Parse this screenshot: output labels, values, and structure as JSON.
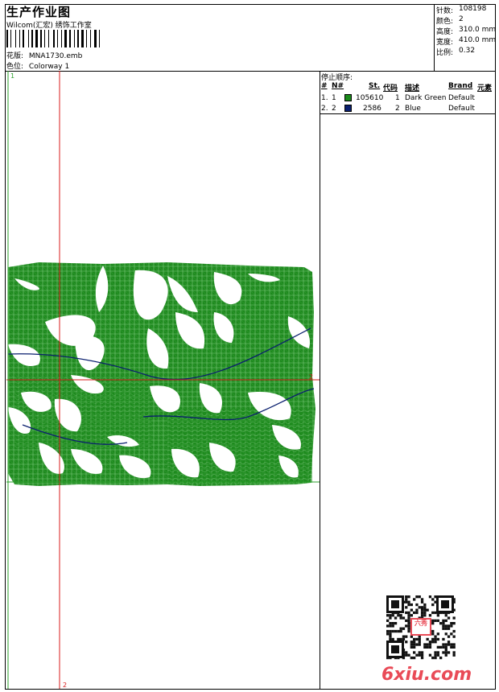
{
  "header": {
    "title": "生产作业图",
    "company": "Wilcom(汇宏) 绣饰工作室",
    "design_label": "花版:",
    "design_value": "MNA1730.emb",
    "colorway_label": "色位:",
    "colorway_value": "Colorway 1"
  },
  "specs": [
    {
      "label": "针数:",
      "value": "108198"
    },
    {
      "label": "颜色:",
      "value": "2"
    },
    {
      "label": "高度:",
      "value": "310.0 mm"
    },
    {
      "label": "宽度:",
      "value": "410.0 mm"
    },
    {
      "label": "比例:",
      "value": "0.32"
    }
  ],
  "stop_sequence": {
    "title": "停止顺序:",
    "columns": [
      "#",
      "N#",
      "St.",
      "代码",
      "描述",
      "Brand",
      "元素"
    ],
    "rows": [
      {
        "num": "1.",
        "n": "1",
        "color": "#1a8a1a",
        "stitches": "105610",
        "code": "1",
        "desc": "Dark Green",
        "brand": "Default"
      },
      {
        "num": "2.",
        "n": "2",
        "color": "#0a1f6e",
        "stitches": "2586",
        "code": "2",
        "desc": "Blue",
        "brand": "Default"
      }
    ]
  },
  "design": {
    "stitch_color": "#1f8a1f",
    "guide_red": "#d81b1b",
    "guide_green": "#2ca02c",
    "marker_top_left": "1",
    "marker_right": "2",
    "marker_bottom": "2"
  },
  "watermark": {
    "site": "6xiu.com",
    "seal": "六秀"
  }
}
